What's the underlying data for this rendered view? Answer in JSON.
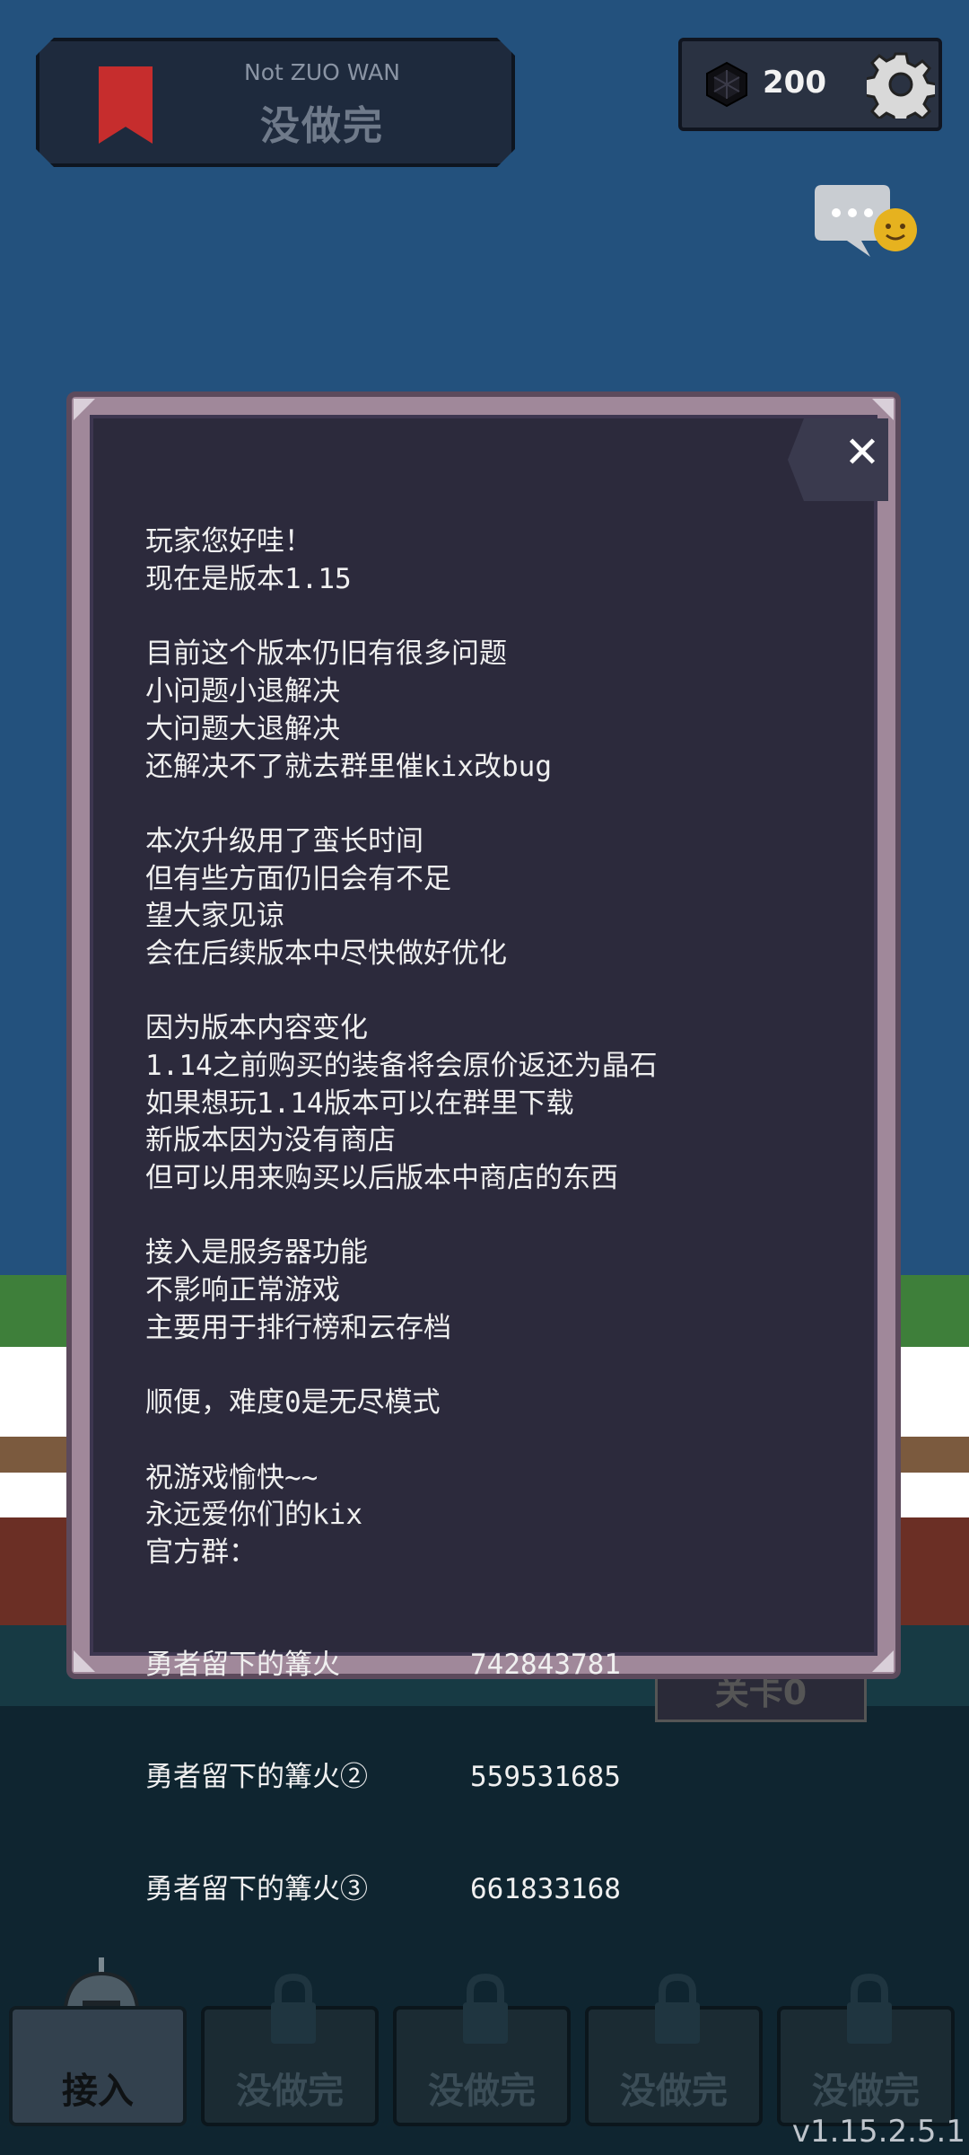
{
  "header": {
    "subtitle": "Not ZUO WAN",
    "title": "没做完"
  },
  "currency": {
    "amount": "200",
    "icon": "gem-icon"
  },
  "dialog": {
    "lines": [
      "玩家您好哇！",
      "现在是版本1.15",
      "",
      "目前这个版本仍旧有很多问题",
      "小问题小退解决",
      "大问题大退解决",
      "还解决不了就去群里催kix改bug",
      "",
      "本次升级用了蛮长时间",
      "但有些方面仍旧会有不足",
      "望大家见谅",
      "会在后续版本中尽快做好优化",
      "",
      "因为版本内容变化",
      "1.14之前购买的装备将会原价返还为晶石",
      "如果想玩1.14版本可以在群里下载",
      "新版本因为没有商店",
      "但可以用来购买以后版本中商店的东西",
      "",
      "接入是服务器功能",
      "不影响正常游戏",
      "主要用于排行榜和云存档",
      "",
      "顺便，难度0是无尽模式",
      "",
      "祝游戏愉快~~",
      "永远爱你们的kix",
      "官方群："
    ],
    "groups": [
      {
        "name": "勇者留下的篝火",
        "number": "742843781"
      },
      {
        "name": "勇者留下的篝火②",
        "number": "559531685"
      },
      {
        "name": "勇者留下的篝火③",
        "number": "661833168"
      }
    ],
    "close_label": "✕"
  },
  "behind_button": "关卡0",
  "tabs": [
    {
      "label": "接入",
      "active": true
    },
    {
      "label": "没做完",
      "active": false
    },
    {
      "label": "没做完",
      "active": false
    },
    {
      "label": "没做完",
      "active": false
    },
    {
      "label": "没做完",
      "active": false
    }
  ],
  "version": "v1.15.2.5.1",
  "colors": {
    "sky": "#23517d",
    "dialog_bg": "#2c2a3c",
    "bookmark": "#c62d2d"
  }
}
